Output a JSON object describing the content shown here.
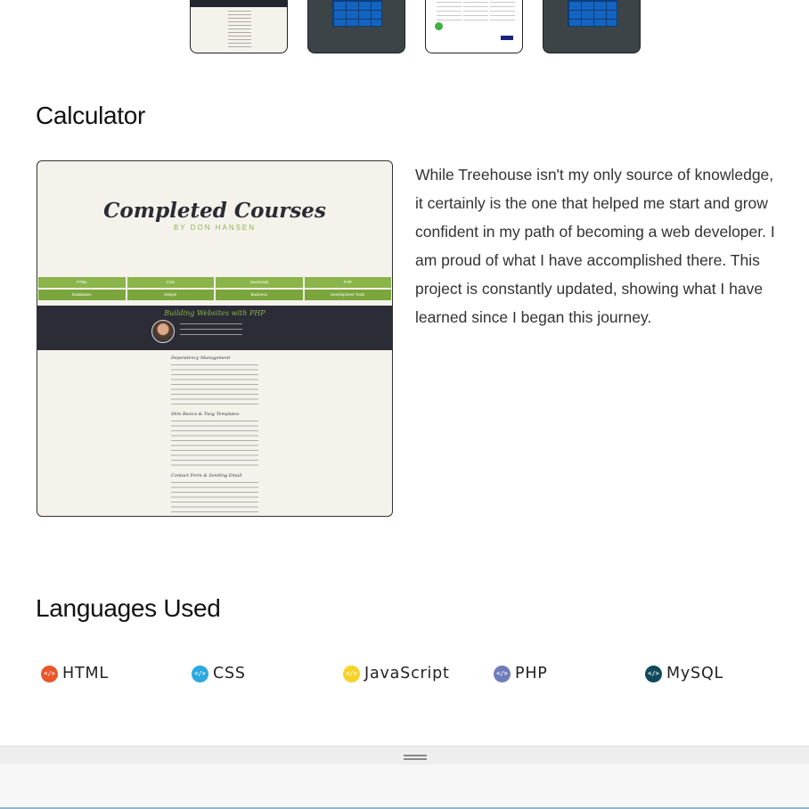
{
  "thumbnails": [
    {
      "kind": "courses"
    },
    {
      "kind": "calculator"
    },
    {
      "kind": "budget"
    },
    {
      "kind": "calculator"
    }
  ],
  "project": {
    "title": "Calculator",
    "image": {
      "heading": "Completed Courses",
      "subheading": "BY DON HANSEN",
      "nav_row1": [
        "HTML",
        "CSS",
        "JavaScript",
        "PHP"
      ],
      "nav_row2": [
        "Databases",
        "Design",
        "Business",
        "Development Tools"
      ],
      "course_title": "Building Websites with PHP",
      "sections": [
        "Dependency Management",
        "Slim Basics & Twig Templates",
        "Contact Form & Sending Email"
      ]
    },
    "description": "While Treehouse isn't my only source of knowledge, it certainly is the one that helped me start and grow confident in my path of becoming a web developer. I am proud of what I have accomplished there. This project is constantly updated, showing what I have learned since I began this journey."
  },
  "languages": {
    "title": "Languages Used",
    "items": [
      {
        "label": "HTML",
        "color": "#e8562a",
        "icon": "code-icon"
      },
      {
        "label": "CSS",
        "color": "#2aa8e0",
        "icon": "code-icon"
      },
      {
        "label": "JavaScript",
        "color": "#f5d327",
        "icon": "code-icon"
      },
      {
        "label": "PHP",
        "color": "#6f7cba",
        "icon": "code-icon"
      },
      {
        "label": "MySQL",
        "color": "#0e4a5c",
        "icon": "code-icon"
      }
    ]
  }
}
